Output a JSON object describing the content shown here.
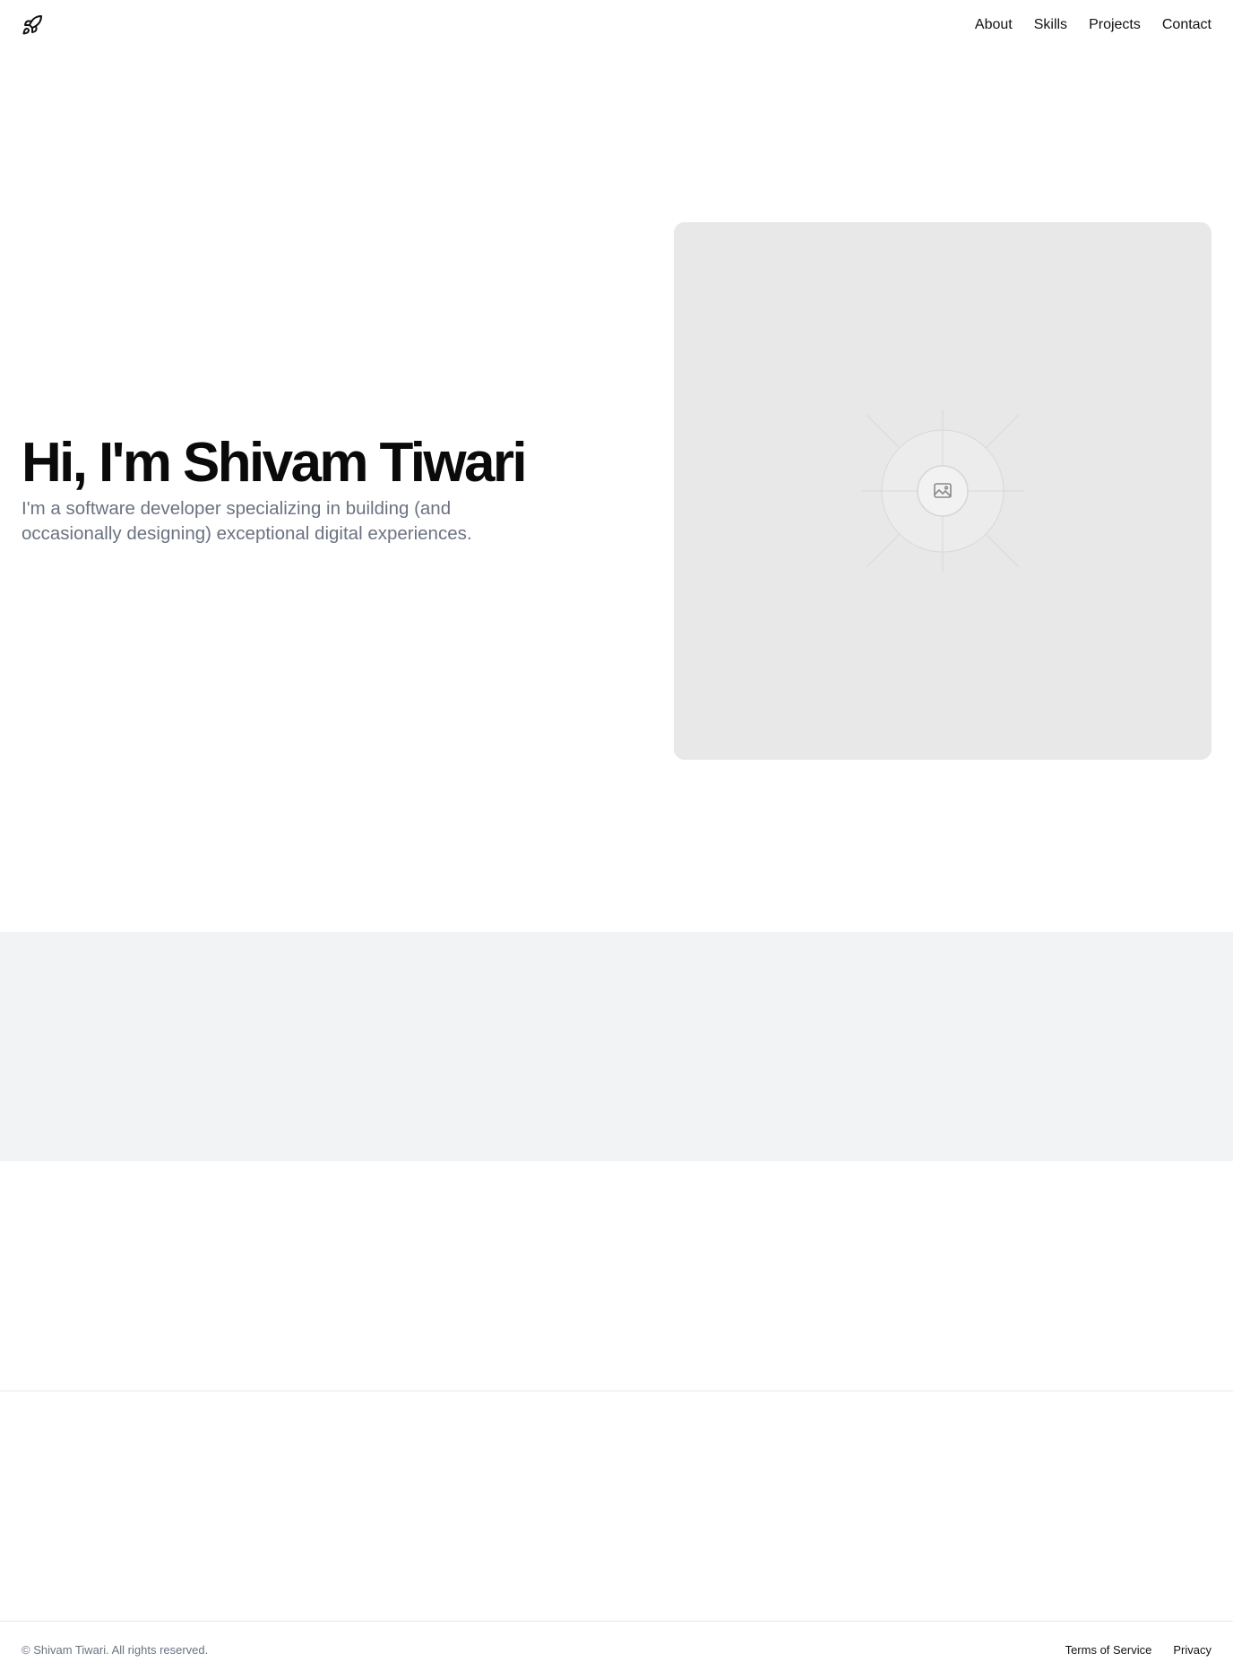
{
  "header": {
    "logo_icon": "rocket-icon",
    "nav": [
      {
        "label": "About"
      },
      {
        "label": "Skills"
      },
      {
        "label": "Projects"
      },
      {
        "label": "Contact"
      }
    ]
  },
  "hero": {
    "title": "Hi, I'm Shivam Tiwari",
    "subtitle": "I'm a software developer specializing in building (and occasionally designing) exceptional digital experiences.",
    "image_icon": "image-placeholder-icon"
  },
  "footer": {
    "copyright": "© Shivam Tiwari. All rights reserved.",
    "links": [
      {
        "label": "Terms of Service"
      },
      {
        "label": "Privacy"
      }
    ]
  },
  "colors": {
    "text": "#0a0a0a",
    "muted": "#6b7280",
    "placeholder_bg": "#e8e8e8",
    "band_bg": "#f2f3f5",
    "border": "#e5e7eb"
  }
}
